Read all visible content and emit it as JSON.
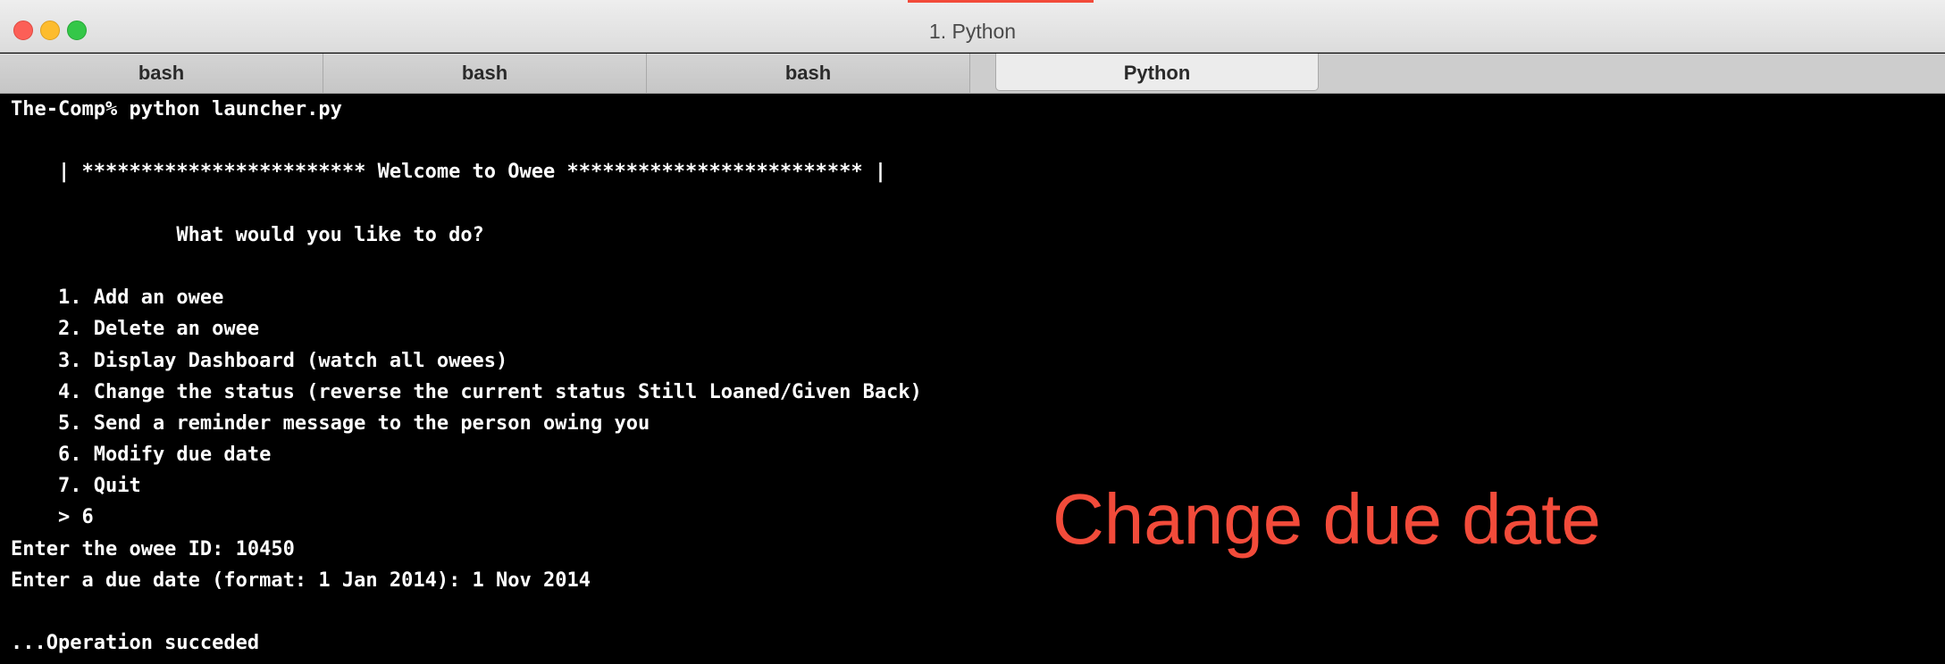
{
  "window": {
    "title": "1. Python"
  },
  "tabs": [
    {
      "label": "bash"
    },
    {
      "label": "bash"
    },
    {
      "label": "bash"
    },
    {
      "label": "Python",
      "active": true
    }
  ],
  "terminal": {
    "lines": [
      "The-Comp% python launcher.py",
      "",
      "    | ************************ Welcome to Owee ************************* |",
      "",
      "              What would you like to do?",
      "",
      "    1. Add an owee",
      "    2. Delete an owee",
      "    3. Display Dashboard (watch all owees)",
      "    4. Change the status (reverse the current status Still Loaned/Given Back)",
      "    5. Send a reminder message to the person owing you",
      "    6. Modify due date",
      "    7. Quit",
      "    > 6",
      "Enter the owee ID: 10450",
      "Enter a due date (format: 1 Jan 2014): 1 Nov 2014",
      "",
      "...Operation succeded"
    ]
  },
  "annotation": {
    "text": "Change due date",
    "color": "#f24b3a"
  },
  "colors": {
    "terminal_bg": "#000000",
    "terminal_fg": "#ffffff",
    "close": "#fc5f57",
    "minimize": "#fdbc2e",
    "maximize": "#34c748"
  }
}
